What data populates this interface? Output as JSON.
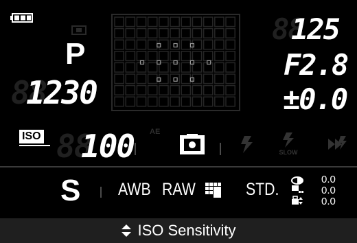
{
  "top": {
    "mode": "P",
    "shots_remaining": "1230",
    "shots_ghost": "88",
    "shutter_speed": "125",
    "shutter_ghost": "88",
    "aperture": "F2.8",
    "exposure_comp": "±0.0",
    "exposure_ghost": ""
  },
  "iso": {
    "badge": "ISO",
    "value": "100",
    "ghost": "88",
    "ae_label": "AE"
  },
  "flash": {
    "slow_label": "SLOW"
  },
  "settings": {
    "mode_letter": "S",
    "white_balance": "AWB",
    "record_mode": "RAW",
    "picture_mode": "STD.",
    "contrast": "0.0",
    "sharpness": "0.0",
    "saturation": "0.0"
  },
  "bottom": {
    "label": "ISO Sensitivity"
  },
  "colors": {
    "background": "#000000",
    "text": "#ffffff",
    "bottom_bar": "#1f1f1f",
    "inactive": "#333333"
  }
}
